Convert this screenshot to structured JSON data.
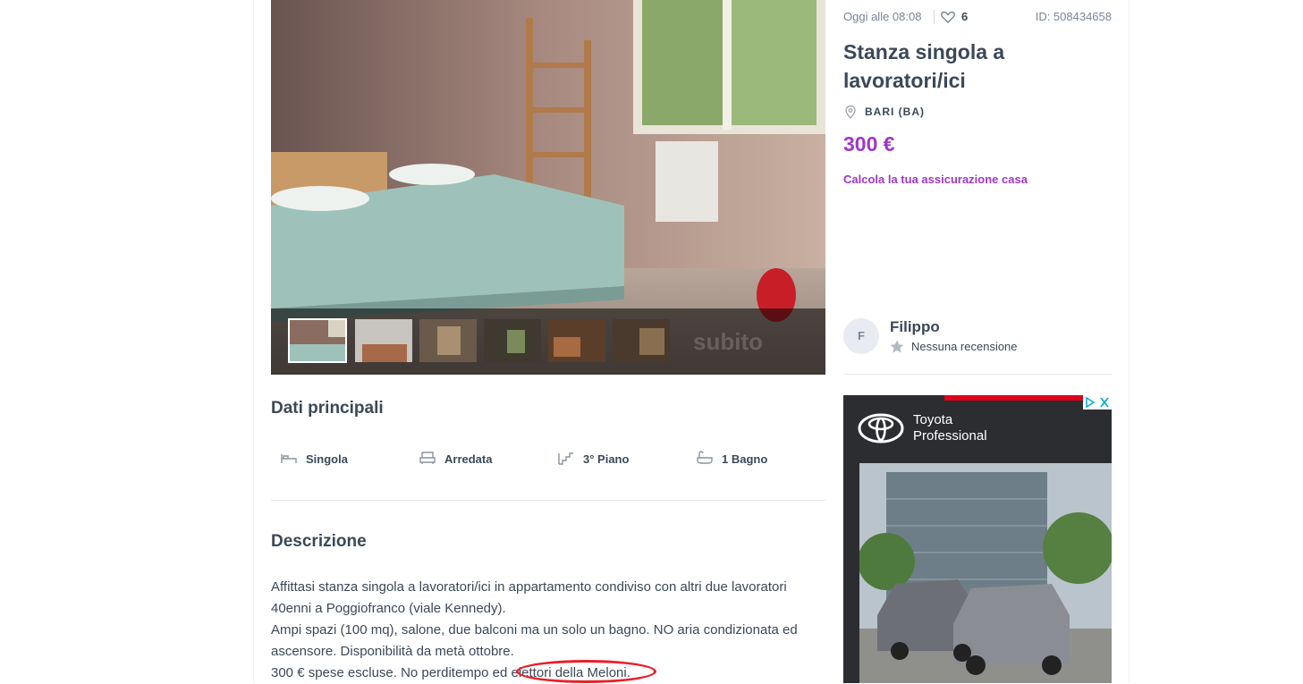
{
  "listing": {
    "date": "Oggi alle 08:08",
    "likes": "6",
    "id": "ID: 508434658",
    "title": "Stanza singola a lavoratori/ici",
    "location": "BARI (BA)",
    "price": "300 €",
    "insurance_link": "Calcola la tua assicurazione casa"
  },
  "gallery": {
    "thumbnail_count": 6,
    "selected_index": 0,
    "watermark": "subito"
  },
  "seller": {
    "initial": "F",
    "name": "Filippo",
    "reviews": "Nessuna recensione"
  },
  "ad": {
    "brand_line1": "Toyota",
    "brand_line2": "Professional"
  },
  "main_data": {
    "title": "Dati principali",
    "features": [
      {
        "icon": "bed-icon",
        "label": "Singola"
      },
      {
        "icon": "furniture-icon",
        "label": "Arredata"
      },
      {
        "icon": "stairs-icon",
        "label": "3° Piano"
      },
      {
        "icon": "bathtub-icon",
        "label": "1 Bagno"
      }
    ]
  },
  "description": {
    "title": "Descrizione",
    "lines": [
      "Affittasi stanza singola a lavoratori/ici in appartamento condiviso con altri due lavoratori",
      "40enni a Poggiofranco (viale Kennedy).",
      "Ampi spazi (100 mq), salone, due balconi ma un solo un bagno. NO aria condizionata ed",
      "ascensore. Disponibilità da metà ottobre.",
      "300 € spese escluse. No perditempo ed elettori della Meloni."
    ],
    "annotation_color": "#e8202a"
  },
  "colors": {
    "accent": "#9d38c9",
    "text": "#3c4858",
    "muted": "#7a8494"
  }
}
